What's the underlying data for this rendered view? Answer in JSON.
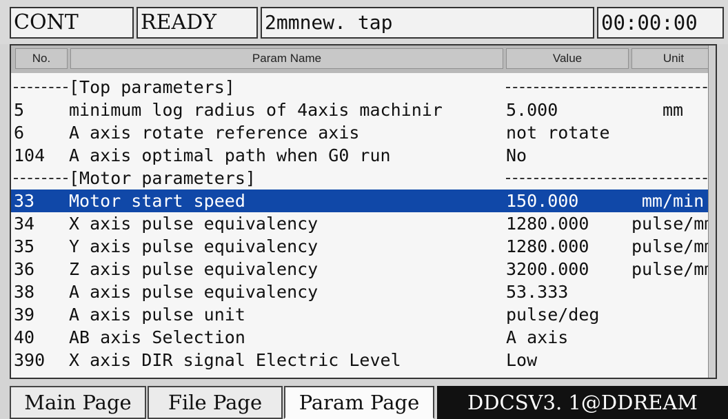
{
  "status": {
    "mode": "CONT",
    "state": "READY",
    "file": "2mmnew. tap",
    "time": "00:00:00"
  },
  "table": {
    "headers": {
      "no": "No.",
      "name": "Param Name",
      "value": "Value",
      "unit": "Unit"
    },
    "rows": [
      {
        "no": "----",
        "name": "[Top parameters]",
        "value": "",
        "unit": "",
        "section": true
      },
      {
        "no": "5",
        "name": "minimum log radius of 4axis machinir",
        "value": "5.000",
        "unit": "mm"
      },
      {
        "no": "6",
        "name": "A axis rotate reference axis",
        "value": "not rotate",
        "unit": ""
      },
      {
        "no": "104",
        "name": "A axis optimal path when G0 run",
        "value": "No",
        "unit": ""
      },
      {
        "no": "----",
        "name": "[Motor parameters]",
        "value": "",
        "unit": "",
        "section": true
      },
      {
        "no": "33",
        "name": "Motor start speed",
        "value": "150.000",
        "unit": "mm/min",
        "selected": true
      },
      {
        "no": "34",
        "name": "X axis pulse equivalency",
        "value": "1280.000",
        "unit": "pulse/mm"
      },
      {
        "no": "35",
        "name": "Y axis pulse equivalency",
        "value": "1280.000",
        "unit": "pulse/mm"
      },
      {
        "no": "36",
        "name": "Z axis pulse equivalency",
        "value": "3200.000",
        "unit": "pulse/mm"
      },
      {
        "no": "38",
        "name": "A axis pulse equivalency",
        "value": "53.333",
        "unit": ""
      },
      {
        "no": "39",
        "name": "A axis pulse unit",
        "value": "pulse/deg",
        "unit": ""
      },
      {
        "no": "40",
        "name": "AB axis Selection",
        "value": "A axis",
        "unit": ""
      },
      {
        "no": "390",
        "name": "X axis DIR signal Electric Level",
        "value": "Low",
        "unit": ""
      }
    ]
  },
  "tabs": {
    "main": "Main Page",
    "file": "File Page",
    "param": "Param Page"
  },
  "brand": "DDCSV3. 1@DDREAM",
  "colors": {
    "selection": "#1048a8",
    "brand_bg": "#111111"
  }
}
